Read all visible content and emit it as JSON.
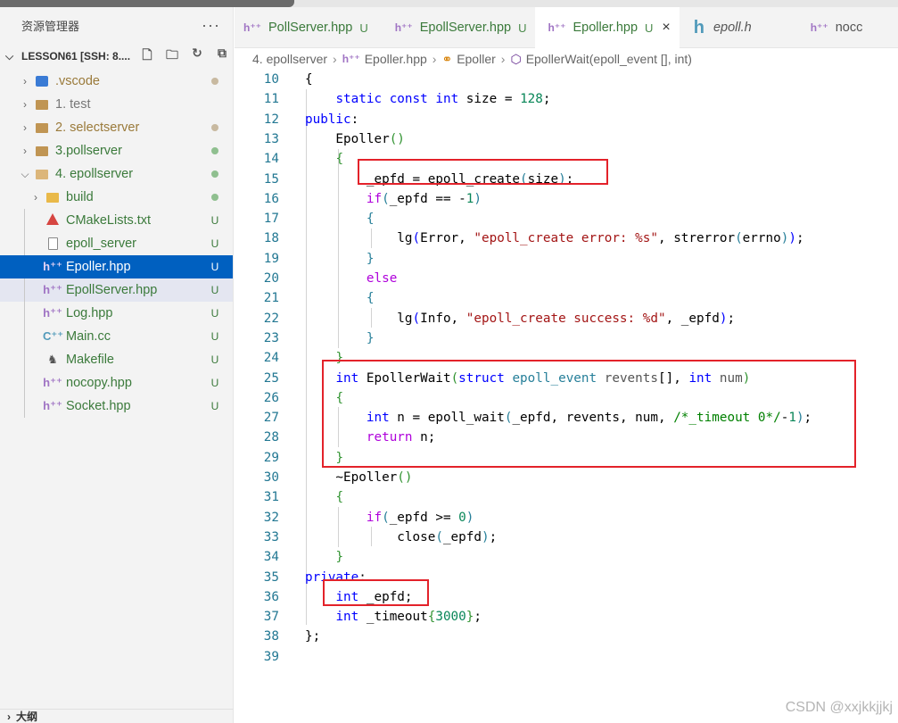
{
  "sidebar": {
    "title": "资源管理器",
    "more": "···",
    "root_label": "LESSON61 [SSH: 8....",
    "items": [
      {
        "label": ".vscode",
        "kind": "vscode",
        "status": "dot"
      },
      {
        "label": "1. test",
        "kind": "folder",
        "status": ""
      },
      {
        "label": "2. selectserver",
        "kind": "folder",
        "status": "dot"
      },
      {
        "label": "3.pollserver",
        "kind": "folder",
        "status": "dot-green"
      },
      {
        "label": "4. epollserver",
        "kind": "folder-open",
        "status": "dot-green"
      },
      {
        "label": "build",
        "kind": "build",
        "status": "dot-green"
      },
      {
        "label": "CMakeLists.txt",
        "kind": "cmake",
        "status": "U"
      },
      {
        "label": "epoll_server",
        "kind": "blank",
        "status": "U"
      },
      {
        "label": "Epoller.hpp",
        "kind": "hpp",
        "status": "U"
      },
      {
        "label": "EpollServer.hpp",
        "kind": "hpp",
        "status": "U"
      },
      {
        "label": "Log.hpp",
        "kind": "hpp",
        "status": "U"
      },
      {
        "label": "Main.cc",
        "kind": "cc",
        "status": "U"
      },
      {
        "label": "Makefile",
        "kind": "make",
        "status": "U"
      },
      {
        "label": "nocopy.hpp",
        "kind": "hpp",
        "status": "U"
      },
      {
        "label": "Socket.hpp",
        "kind": "hpp",
        "status": "U"
      }
    ],
    "outline_label": "大纲"
  },
  "tabs": [
    {
      "label": "PollServer.hpp",
      "mod": "U"
    },
    {
      "label": "EpollServer.hpp",
      "mod": "U"
    },
    {
      "label": "Epoller.hpp",
      "mod": "U",
      "close": "×"
    },
    {
      "label": "epoll.h"
    },
    {
      "label": "nocc"
    }
  ],
  "breadcrumb": {
    "folder": "4. epollserver",
    "file": "Epoller.hpp",
    "class": "Epoller",
    "method": "EpollerWait(epoll_event [], int)"
  },
  "code": {
    "line_numbers": [
      "10",
      "11",
      "12",
      "13",
      "14",
      "15",
      "16",
      "17",
      "18",
      "19",
      "20",
      "21",
      "22",
      "23",
      "24",
      "25",
      "26",
      "27",
      "28",
      "29",
      "30",
      "31",
      "32",
      "33",
      "34",
      "35",
      "36",
      "37",
      "38",
      "39"
    ]
  },
  "watermark": "CSDN @xxjkkjjkj",
  "colors": {
    "selection": "#0060c0",
    "highlight_box": "#e3222a",
    "keyword": "#0000ff",
    "string": "#a31515",
    "number": "#098658",
    "comment": "#008000"
  }
}
